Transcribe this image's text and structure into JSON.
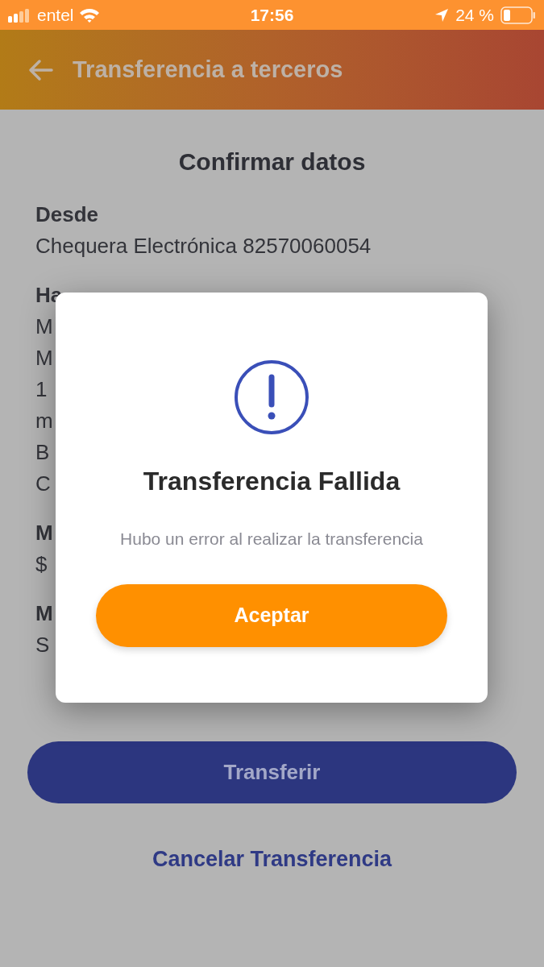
{
  "status_bar": {
    "carrier": "entel",
    "time": "17:56",
    "battery": "24 %"
  },
  "header": {
    "title": "Transferencia a terceros"
  },
  "content": {
    "heading": "Confirmar datos",
    "sections": [
      {
        "label": "Desde",
        "lines": [
          "Chequera Electrónica 82570060054"
        ]
      },
      {
        "label": "Ha",
        "lines": [
          "M",
          "M",
          "1",
          "m",
          "B",
          "C"
        ]
      },
      {
        "label": "M",
        "lines": [
          "$"
        ]
      },
      {
        "label": "M",
        "lines": [
          "S"
        ]
      }
    ]
  },
  "dialog": {
    "title": "Transferencia Fallida",
    "message": "Hubo un error al realizar la transferencia",
    "button": "Aceptar"
  },
  "actions": {
    "primary": "Transferir",
    "secondary": "Cancelar Transferencia"
  }
}
